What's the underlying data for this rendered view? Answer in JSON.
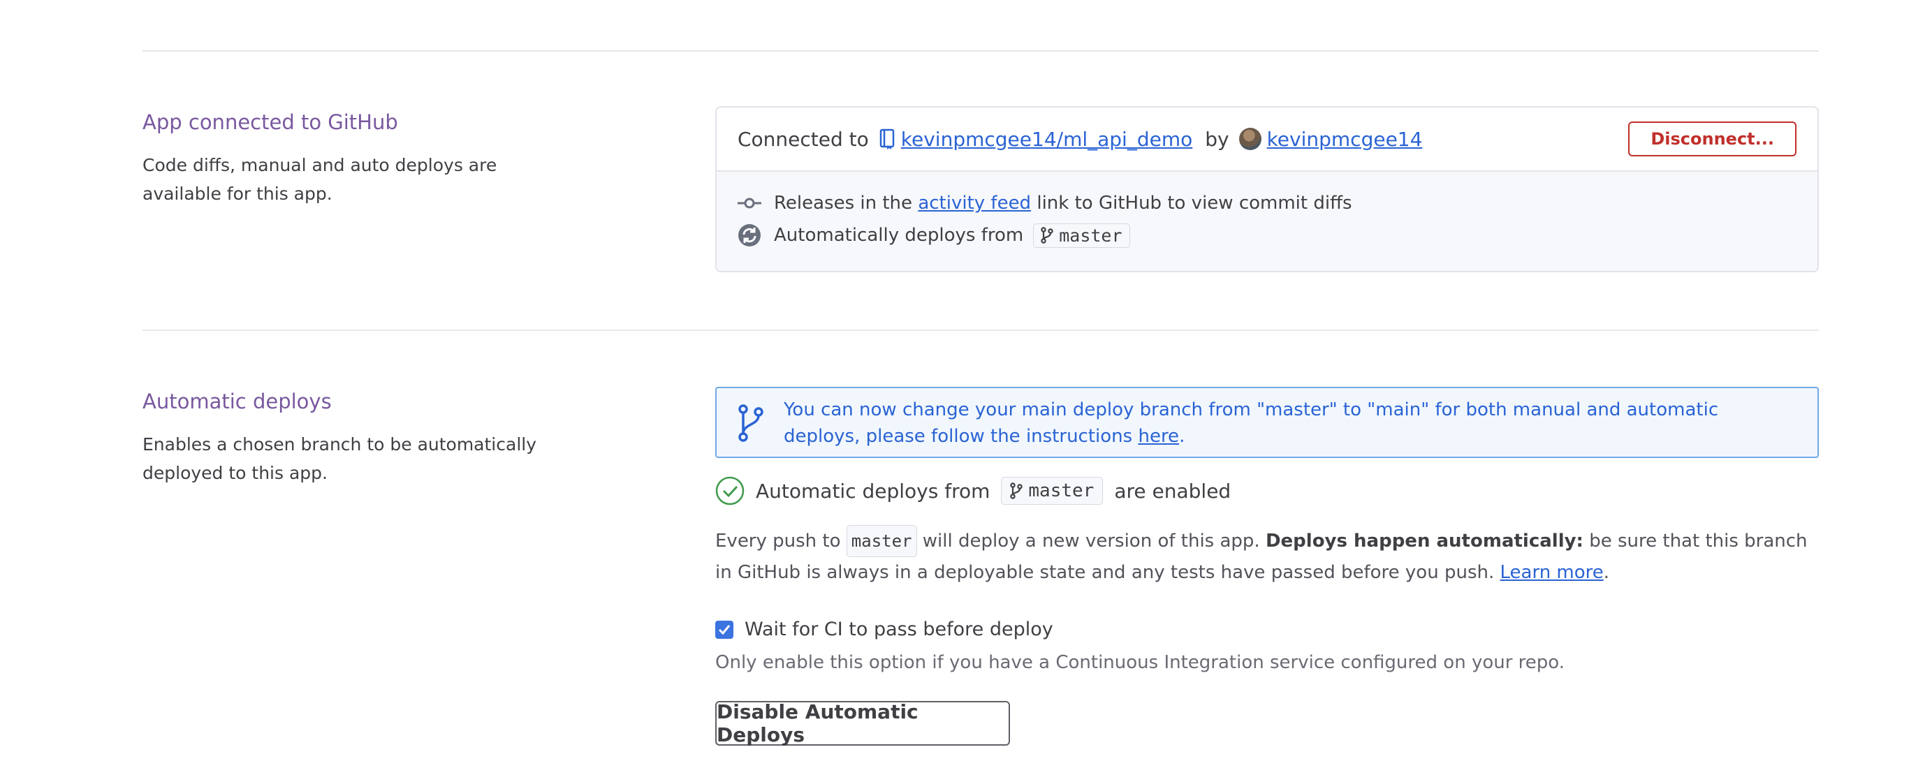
{
  "github": {
    "title": "App connected to GitHub",
    "description": "Code diffs, manual and auto deploys are available for this app.",
    "connected_prefix": "Connected to",
    "repo": "kevinpmcgee14/ml_api_demo",
    "by": "by",
    "user": "kevinpmcgee14",
    "disconnect_label": "Disconnect...",
    "releases_prefix": "Releases in the",
    "activity_feed": "activity feed",
    "releases_suffix": "link to GitHub to view commit diffs",
    "auto_deploys_from": "Automatically deploys from",
    "branch": "master"
  },
  "auto": {
    "title": "Automatic deploys",
    "description": "Enables a chosen branch to be automatically deployed to this app.",
    "info_text": "You can now change your main deploy branch from \"master\" to \"main\" for both manual and automatic deploys, please follow the instructions",
    "info_link": "here",
    "status_prefix": "Automatic deploys from",
    "branch": "master",
    "status_suffix": "are enabled",
    "para_1": "Every push to",
    "para_2": "will deploy a new version of this app.",
    "para_bold": "Deploys happen automatically:",
    "para_3": "be sure that this branch in GitHub is always in a deployable state and any tests have passed before you push.",
    "learn_more": "Learn more",
    "wait_ci_label": "Wait for CI to pass before deploy",
    "wait_ci_checked": true,
    "ci_hint": "Only enable this option if you have a Continuous Integration service configured on your repo.",
    "disable_label": "Disable Automatic Deploys"
  },
  "colors": {
    "accent_purple": "#79589f",
    "link_blue": "#2a63d4",
    "danger_red": "#c0302c",
    "success_green": "#3f9a4c"
  }
}
